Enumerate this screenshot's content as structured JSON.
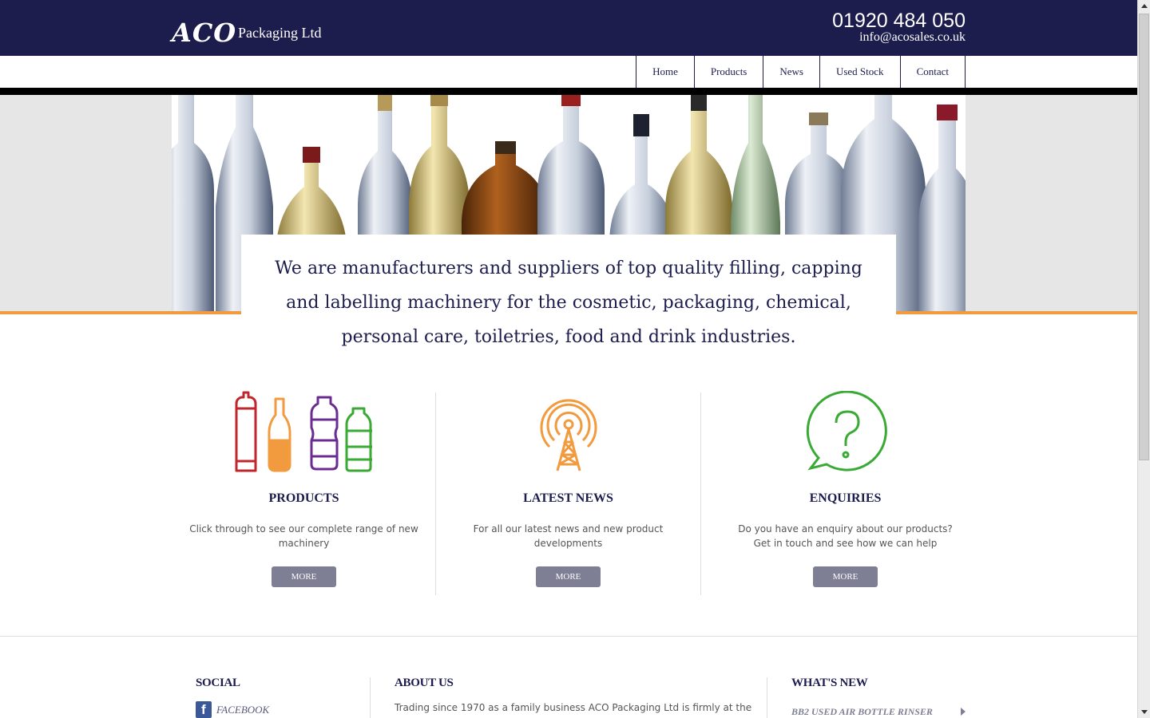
{
  "header": {
    "logo_mark": "ACO",
    "logo_text": "Packaging Ltd",
    "phone": "01920 484 050",
    "email": "info@acosales.co.uk"
  },
  "nav": {
    "items": [
      {
        "label": "Home"
      },
      {
        "label": "Products"
      },
      {
        "label": "News"
      },
      {
        "label": "Used Stock"
      },
      {
        "label": "Contact"
      }
    ]
  },
  "hero": {
    "text": "We are manufacturers and suppliers of top quality filling, capping and labelling machinery for the cosmetic, packaging, chemical, personal care, toiletries, food and drink industries."
  },
  "features": [
    {
      "icon": "bottles-icon",
      "title": "PRODUCTS",
      "text": "Click through to see our complete range of new machinery",
      "button": "MORE"
    },
    {
      "icon": "broadcast-tower-icon",
      "title": "LATEST NEWS",
      "text": "For all our latest news and new product developments",
      "button": "MORE"
    },
    {
      "icon": "question-bubble-icon",
      "title": "ENQUIRIES",
      "text": "Do you have an enquiry about our products? Get in touch and see how we can help",
      "button": "MORE"
    }
  ],
  "footer": {
    "social": {
      "heading": "SOCIAL",
      "facebook_label": "FACEBOOK"
    },
    "about": {
      "heading": "ABOUT US",
      "text": "Trading since 1970 as a family business ACO Packaging Ltd is firmly at the"
    },
    "whats_new": {
      "heading": "WHAT'S NEW",
      "item": "BB2 USED AIR BOTTLE RINSER"
    }
  },
  "colors": {
    "navy": "#1c1c4d",
    "orange": "#f29a3e",
    "red": "#c0272d",
    "purple": "#6b2c91",
    "green": "#3aaa35",
    "button_grey": "#7e7e94"
  }
}
